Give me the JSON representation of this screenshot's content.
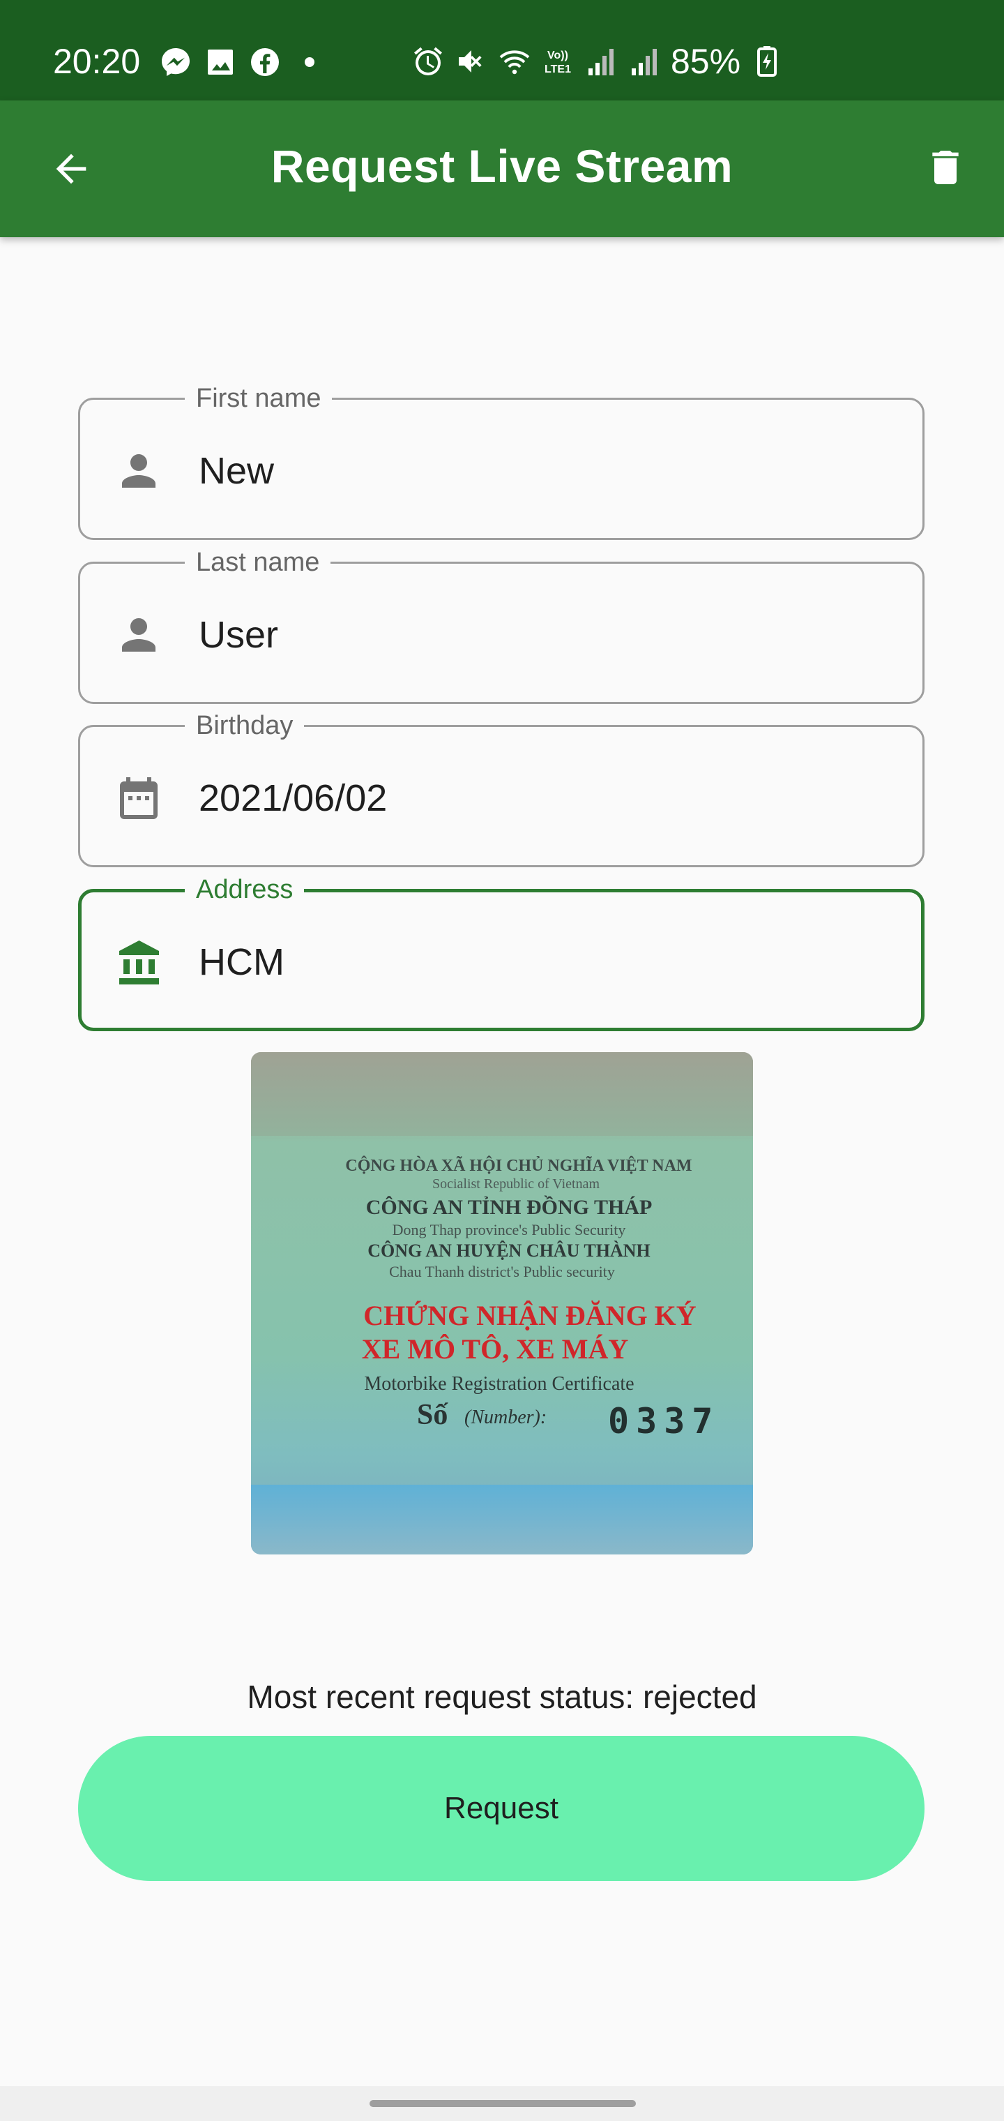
{
  "status_bar": {
    "time": "20:20",
    "battery_percent": "85%",
    "left_icons": [
      "messenger-icon",
      "gallery-icon",
      "facebook-icon",
      "dot-icon"
    ],
    "right_icons": [
      "alarm-icon",
      "mute-icon",
      "wifi-icon",
      "volte-icon",
      "signal-icon",
      "signal-icon",
      "battery-charging-icon"
    ]
  },
  "app_bar": {
    "title": "Request Live Stream",
    "back_icon": "arrow-back-icon",
    "delete_icon": "trash-icon"
  },
  "form": {
    "first_name": {
      "label": "First name",
      "value": "New",
      "icon": "person-icon"
    },
    "last_name": {
      "label": "Last name",
      "value": "User",
      "icon": "person-icon"
    },
    "birthday": {
      "label": "Birthday",
      "value": "2021/06/02",
      "icon": "calendar-icon"
    },
    "address": {
      "label": "Address",
      "value": "HCM",
      "icon": "bank-icon",
      "focused": true
    }
  },
  "photo": {
    "lines": [
      "CỘNG HÒA XÃ HỘI CHỦ NGHĨA VIỆT NAM",
      "Socialist Republic of Vietnam",
      "CÔNG AN TỈNH ĐỒNG THÁP",
      "Dong Thap province's Public Security",
      "CÔNG AN HUYỆN CHÂU THÀNH",
      "Chau Thanh district's Public security",
      "CHỨNG NHẬN ĐĂNG KÝ",
      "XE MÔ TÔ, XE MÁY",
      "Motorbike Registration Certificate",
      "Số",
      "(Number):",
      "0337"
    ]
  },
  "status": {
    "text": "Most recent request status: rejected"
  },
  "request_button": {
    "label": "Request"
  },
  "colors": {
    "status_bar": "#1b5e20",
    "app_bar": "#2e7d32",
    "accent": "#2e7d32",
    "button": "#69f0ae",
    "doc_red": "#d0262a"
  }
}
